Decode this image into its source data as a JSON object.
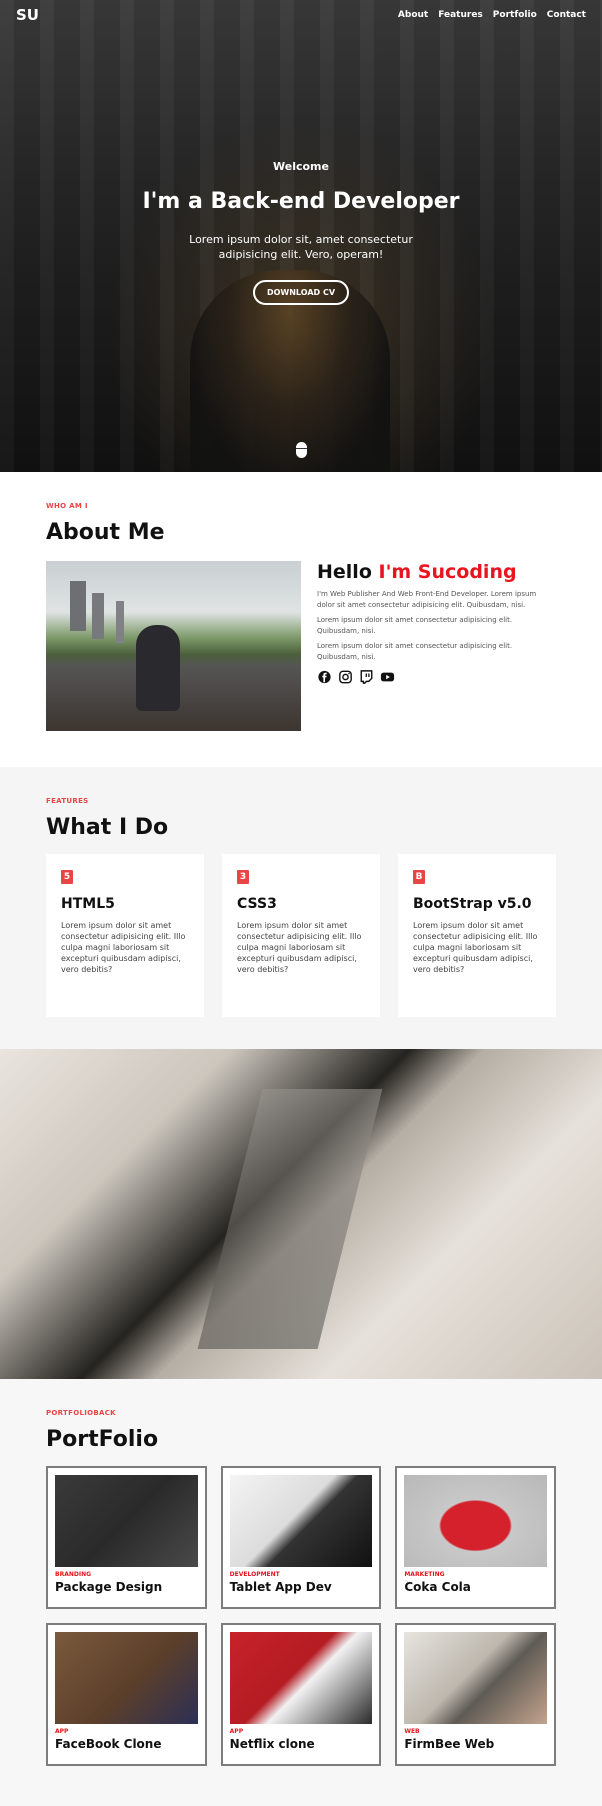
{
  "nav": {
    "brand": "SU",
    "links": [
      "About",
      "Features",
      "Portfolio",
      "Contact"
    ]
  },
  "hero": {
    "welcome": "Welcome",
    "title": "I'm a Back-end Developer",
    "description": "Lorem ipsum dolor sit, amet consectetur adipisicing elit. Vero, operam!",
    "button_label": "DOWNLOAD CV"
  },
  "about": {
    "kicker": "WHO AM I",
    "title": "About Me",
    "hello": "Hello",
    "name": "I'm Sucoding",
    "paragraphs": [
      "I'm Web Publisher And Web Front-End Developer. Lorem ipsum dolor sit amet consectetur adipisicing elit. Quibusdam, nisi.",
      "Lorem ipsum dolor sit amet consectetur adipisicing elit. Quibusdam, nisi.",
      "Lorem ipsum dolor sit amet consectetur adipisicing elit. Quibusdam, nisi."
    ],
    "social_icons": [
      "facebook-icon",
      "instagram-icon",
      "twitch-icon",
      "youtube-icon"
    ]
  },
  "features": {
    "kicker": "FEATURES",
    "title": "What I Do",
    "cards": [
      {
        "icon": "html5-icon",
        "title": "HTML5",
        "body": "Lorem ipsum dolor sit amet consectetur adipisicing elit. Illo culpa magni laboriosam sit excepturi quibusdam adipisci, vero debitis?"
      },
      {
        "icon": "css3-icon",
        "title": "CSS3",
        "body": "Lorem ipsum dolor sit amet consectetur adipisicing elit. Illo culpa magni laboriosam sit excepturi quibusdam adipisci, vero debitis?"
      },
      {
        "icon": "bootstrap-icon",
        "title": "BootStrap v5.0",
        "body": "Lorem ipsum dolor sit amet consectetur adipisicing elit. Illo culpa magni laboriosam sit excepturi quibusdam adipisci, vero debitis?"
      }
    ]
  },
  "portfolio": {
    "kicker": "PORTFOLIOBACK",
    "title": "PortFolio",
    "items": [
      {
        "category": "BRANDING",
        "title": "Package Design"
      },
      {
        "category": "DEVELOPMENT",
        "title": "Tablet App Dev"
      },
      {
        "category": "MARKETING",
        "title": "Coka Cola"
      },
      {
        "category": "APP",
        "title": "FaceBook Clone"
      },
      {
        "category": "APP",
        "title": "Netflix clone"
      },
      {
        "category": "WEB",
        "title": "FirmBee Web"
      }
    ]
  }
}
